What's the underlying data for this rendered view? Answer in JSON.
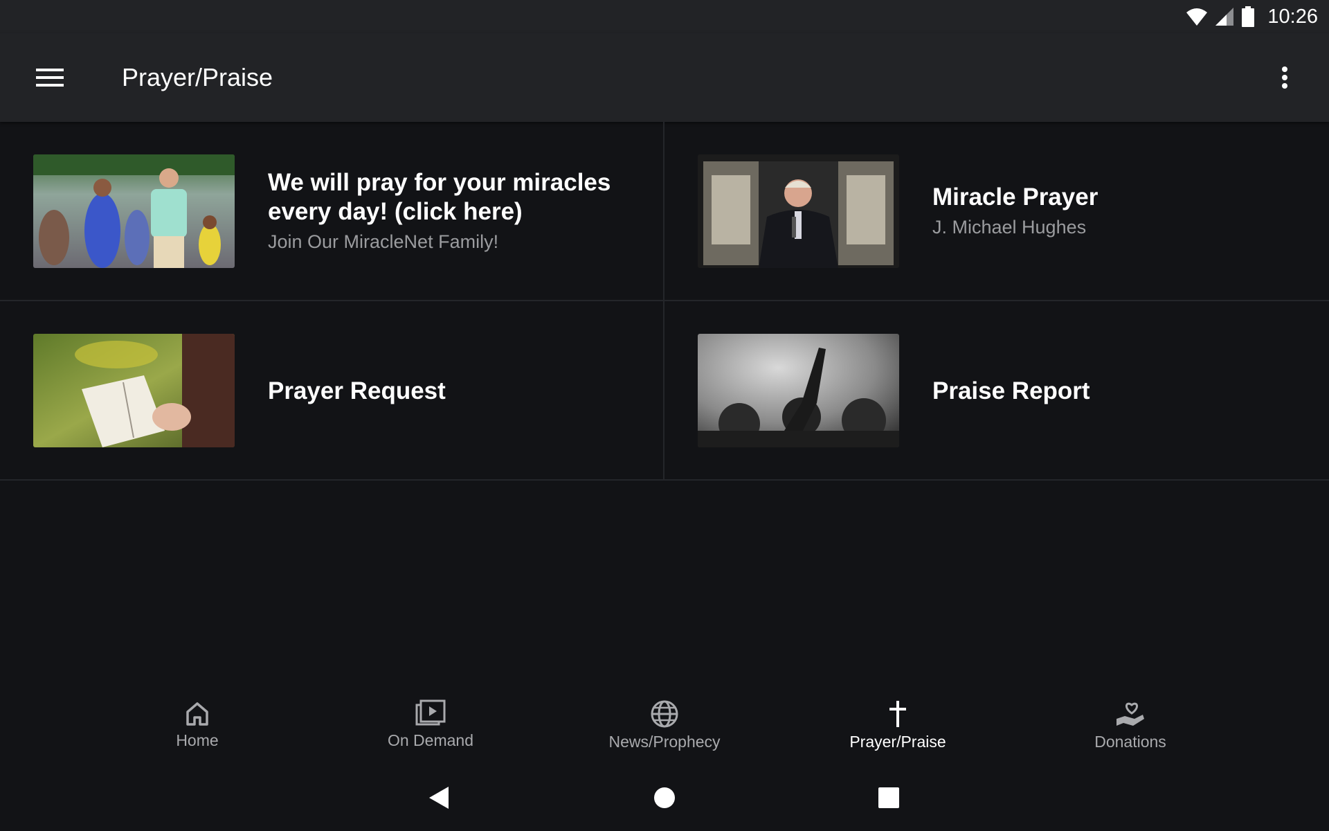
{
  "status_bar": {
    "time": "10:26"
  },
  "app_bar": {
    "title": "Prayer/Praise"
  },
  "tiles": [
    {
      "title": "We will pray for your miracles every day! (click here)",
      "subtitle": "Join Our MiracleNet Family!"
    },
    {
      "title": "Miracle Prayer",
      "subtitle": "J. Michael Hughes"
    },
    {
      "title": "Prayer Request"
    },
    {
      "title": "Praise Report"
    }
  ],
  "bottom_nav": [
    {
      "label": "Home",
      "icon": "home-icon"
    },
    {
      "label": "On Demand",
      "icon": "video-library-icon"
    },
    {
      "label": "News/Prophecy",
      "icon": "globe-icon"
    },
    {
      "label": "Prayer/Praise",
      "icon": "cross-icon",
      "active": true
    },
    {
      "label": "Donations",
      "icon": "heart-hand-icon"
    }
  ],
  "colors": {
    "app_bar": "#222326",
    "background": "#121316",
    "inactive_label": "#a9aaad",
    "subtitle": "#9b9c9f"
  }
}
